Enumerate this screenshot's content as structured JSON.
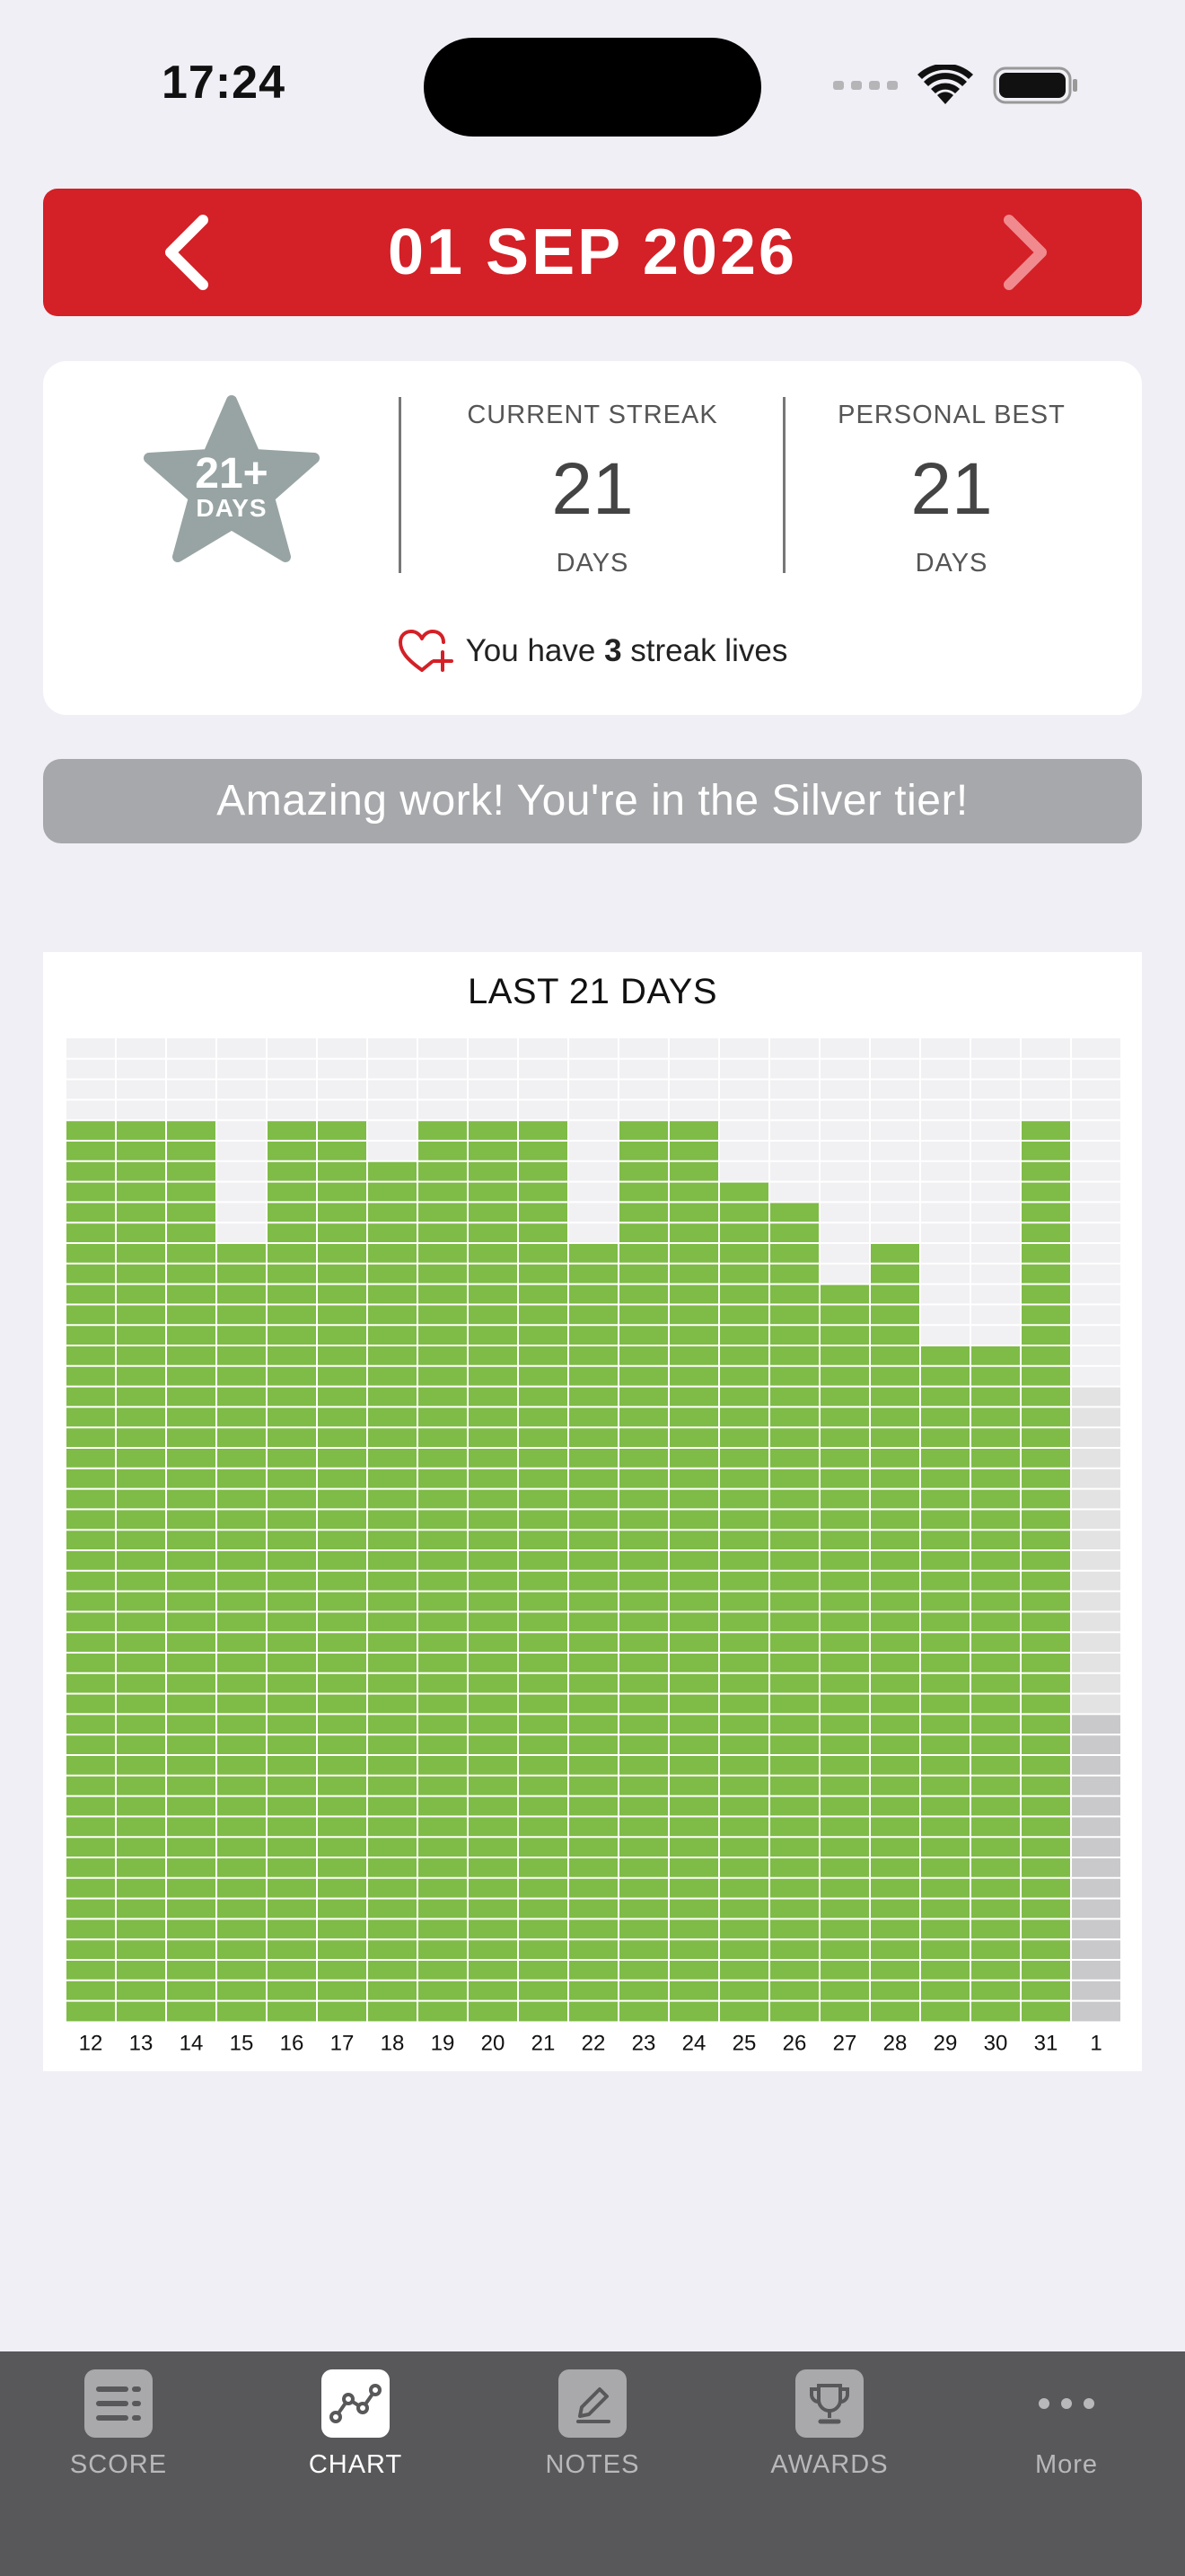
{
  "status": {
    "time": "17:24"
  },
  "header": {
    "date": "01 SEP 2026"
  },
  "streak": {
    "badge_number": "21+",
    "badge_unit": "DAYS",
    "current_label": "CURRENT STREAK",
    "current_value": "21",
    "current_unit": "DAYS",
    "best_label": "PERSONAL BEST",
    "best_value": "21",
    "best_unit": "DAYS",
    "lives_prefix": "You have ",
    "lives_count": "3",
    "lives_suffix": " streak lives"
  },
  "tier_message": "Amazing work! You're in the Silver tier!",
  "chart_data": {
    "type": "bar",
    "title": "LAST 21 DAYS",
    "categories": [
      "12",
      "13",
      "14",
      "15",
      "16",
      "17",
      "18",
      "19",
      "20",
      "21",
      "22",
      "23",
      "24",
      "25",
      "26",
      "27",
      "28",
      "29",
      "30",
      "31",
      "1"
    ],
    "values": [
      44,
      44,
      44,
      38,
      44,
      44,
      42,
      44,
      44,
      44,
      38,
      44,
      44,
      41,
      40,
      36,
      38,
      33,
      33,
      44,
      31
    ],
    "max_segments": 48,
    "completed_count": 20,
    "colors": {
      "complete": "#7fbb47",
      "today_light": "#e3e3e4",
      "today_dark": "#c9c9cb",
      "empty": "#f1f1f4"
    }
  },
  "tabs": [
    {
      "label": "SCORE",
      "icon": "score-list-icon",
      "active": false
    },
    {
      "label": "CHART",
      "icon": "chart-line-icon",
      "active": true
    },
    {
      "label": "NOTES",
      "icon": "pencil-icon",
      "active": false
    },
    {
      "label": "AWARDS",
      "icon": "trophy-icon",
      "active": false
    },
    {
      "label": "More",
      "icon": "more-dots-icon",
      "active": false
    }
  ]
}
